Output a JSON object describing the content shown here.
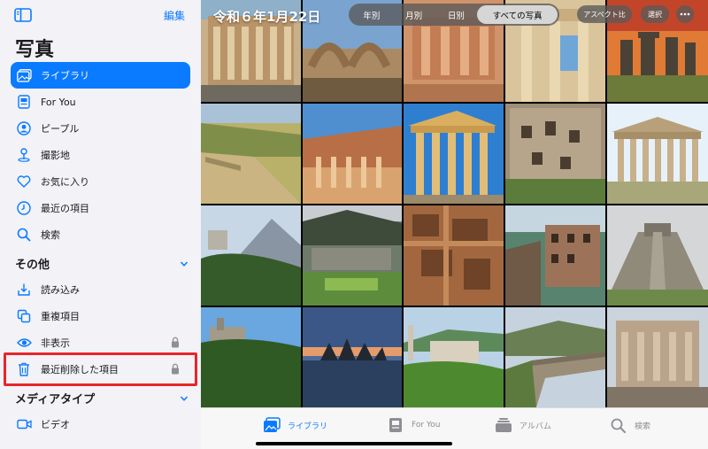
{
  "sidebar": {
    "edit_label": "編集",
    "title": "写真",
    "items": [
      {
        "label": "ライブラリ",
        "icon": "photo-library-icon",
        "active": true
      },
      {
        "label": "For You",
        "icon": "for-you-icon"
      },
      {
        "label": "ピープル",
        "icon": "person-icon"
      },
      {
        "label": "撮影地",
        "icon": "map-pin-icon"
      },
      {
        "label": "お気に入り",
        "icon": "heart-icon"
      },
      {
        "label": "最近の項目",
        "icon": "clock-icon"
      },
      {
        "label": "検索",
        "icon": "search-icon"
      }
    ],
    "section_other": "その他",
    "other_items": [
      {
        "label": "読み込み",
        "icon": "import-icon"
      },
      {
        "label": "重複項目",
        "icon": "duplicates-icon"
      },
      {
        "label": "非表示",
        "icon": "eye-icon",
        "locked": true
      },
      {
        "label": "最近削除した項目",
        "icon": "trash-icon",
        "locked": true
      }
    ],
    "section_media": "メディアタイプ",
    "media_items": [
      {
        "label": "ビデオ",
        "icon": "video-icon"
      }
    ]
  },
  "main": {
    "date_title": "令和６年1月22日",
    "segments": [
      "年別",
      "月別",
      "日別",
      "すべての写真"
    ],
    "active_segment": "すべての写真",
    "aspect_label": "アスペクト比",
    "select_label": "選択",
    "tabs": [
      {
        "label": "ライブラリ",
        "icon": "photo-library-icon",
        "active": true
      },
      {
        "label": "For You",
        "icon": "for-you-icon"
      },
      {
        "label": "アルバム",
        "icon": "album-icon"
      },
      {
        "label": "検索",
        "icon": "search-icon"
      }
    ]
  },
  "colors": {
    "accent": "#0a7aff",
    "highlight": "#e8262a",
    "sidebar_bg": "#f2f2f7"
  }
}
